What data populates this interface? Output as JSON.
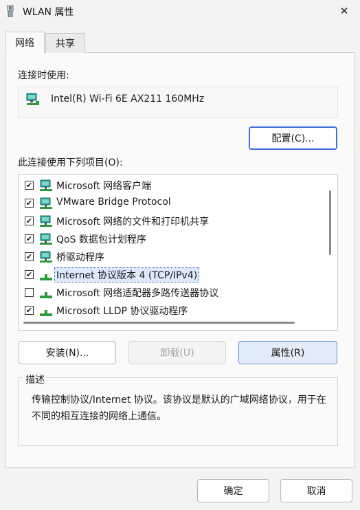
{
  "window": {
    "title": "WLAN 属性",
    "close_glyph": "✕"
  },
  "tabs": [
    {
      "label": "网络",
      "active": true
    },
    {
      "label": "共享",
      "active": false
    }
  ],
  "connection": {
    "label": "连接时使用:",
    "adapter_name": "Intel(R) Wi-Fi 6E AX211 160MHz",
    "adapter_icon": "network-adapter-icon",
    "configure_label": "配置(C)..."
  },
  "items_section": {
    "label": "此连接使用下列项目(O):",
    "items": [
      {
        "checked": true,
        "label": "Microsoft 网络客户端",
        "icon": "network-client-icon",
        "selected": false
      },
      {
        "checked": true,
        "label": "VMware Bridge Protocol",
        "icon": "network-service-icon",
        "selected": false
      },
      {
        "checked": true,
        "label": "Microsoft 网络的文件和打印机共享",
        "icon": "network-service-icon",
        "selected": false
      },
      {
        "checked": true,
        "label": "QoS 数据包计划程序",
        "icon": "network-service-icon",
        "selected": false
      },
      {
        "checked": true,
        "label": "桥驱动程序",
        "icon": "network-service-icon",
        "selected": false
      },
      {
        "checked": true,
        "label": "Internet 协议版本 4 (TCP/IPv4)",
        "icon": "protocol-icon",
        "selected": true
      },
      {
        "checked": false,
        "label": "Microsoft 网络适配器多路传送器协议",
        "icon": "protocol-icon",
        "selected": false
      },
      {
        "checked": true,
        "label": "Microsoft LLDP 协议驱动程序",
        "icon": "protocol-icon",
        "selected": false
      }
    ]
  },
  "buttons": {
    "install": "安装(N)...",
    "uninstall": "卸载(U)",
    "properties": "属性(R)",
    "ok": "确定",
    "cancel": "取消"
  },
  "description": {
    "legend": "描述",
    "text": "传输控制协议/Internet 协议。该协议是默认的广域网络协议，用于在不同的相互连接的网络上通信。"
  },
  "colors": {
    "accent": "#3a6fd8",
    "selection": "#ddeafc",
    "monitor_teal": "#2aa198",
    "protocol_green": "#2e9a3e"
  }
}
